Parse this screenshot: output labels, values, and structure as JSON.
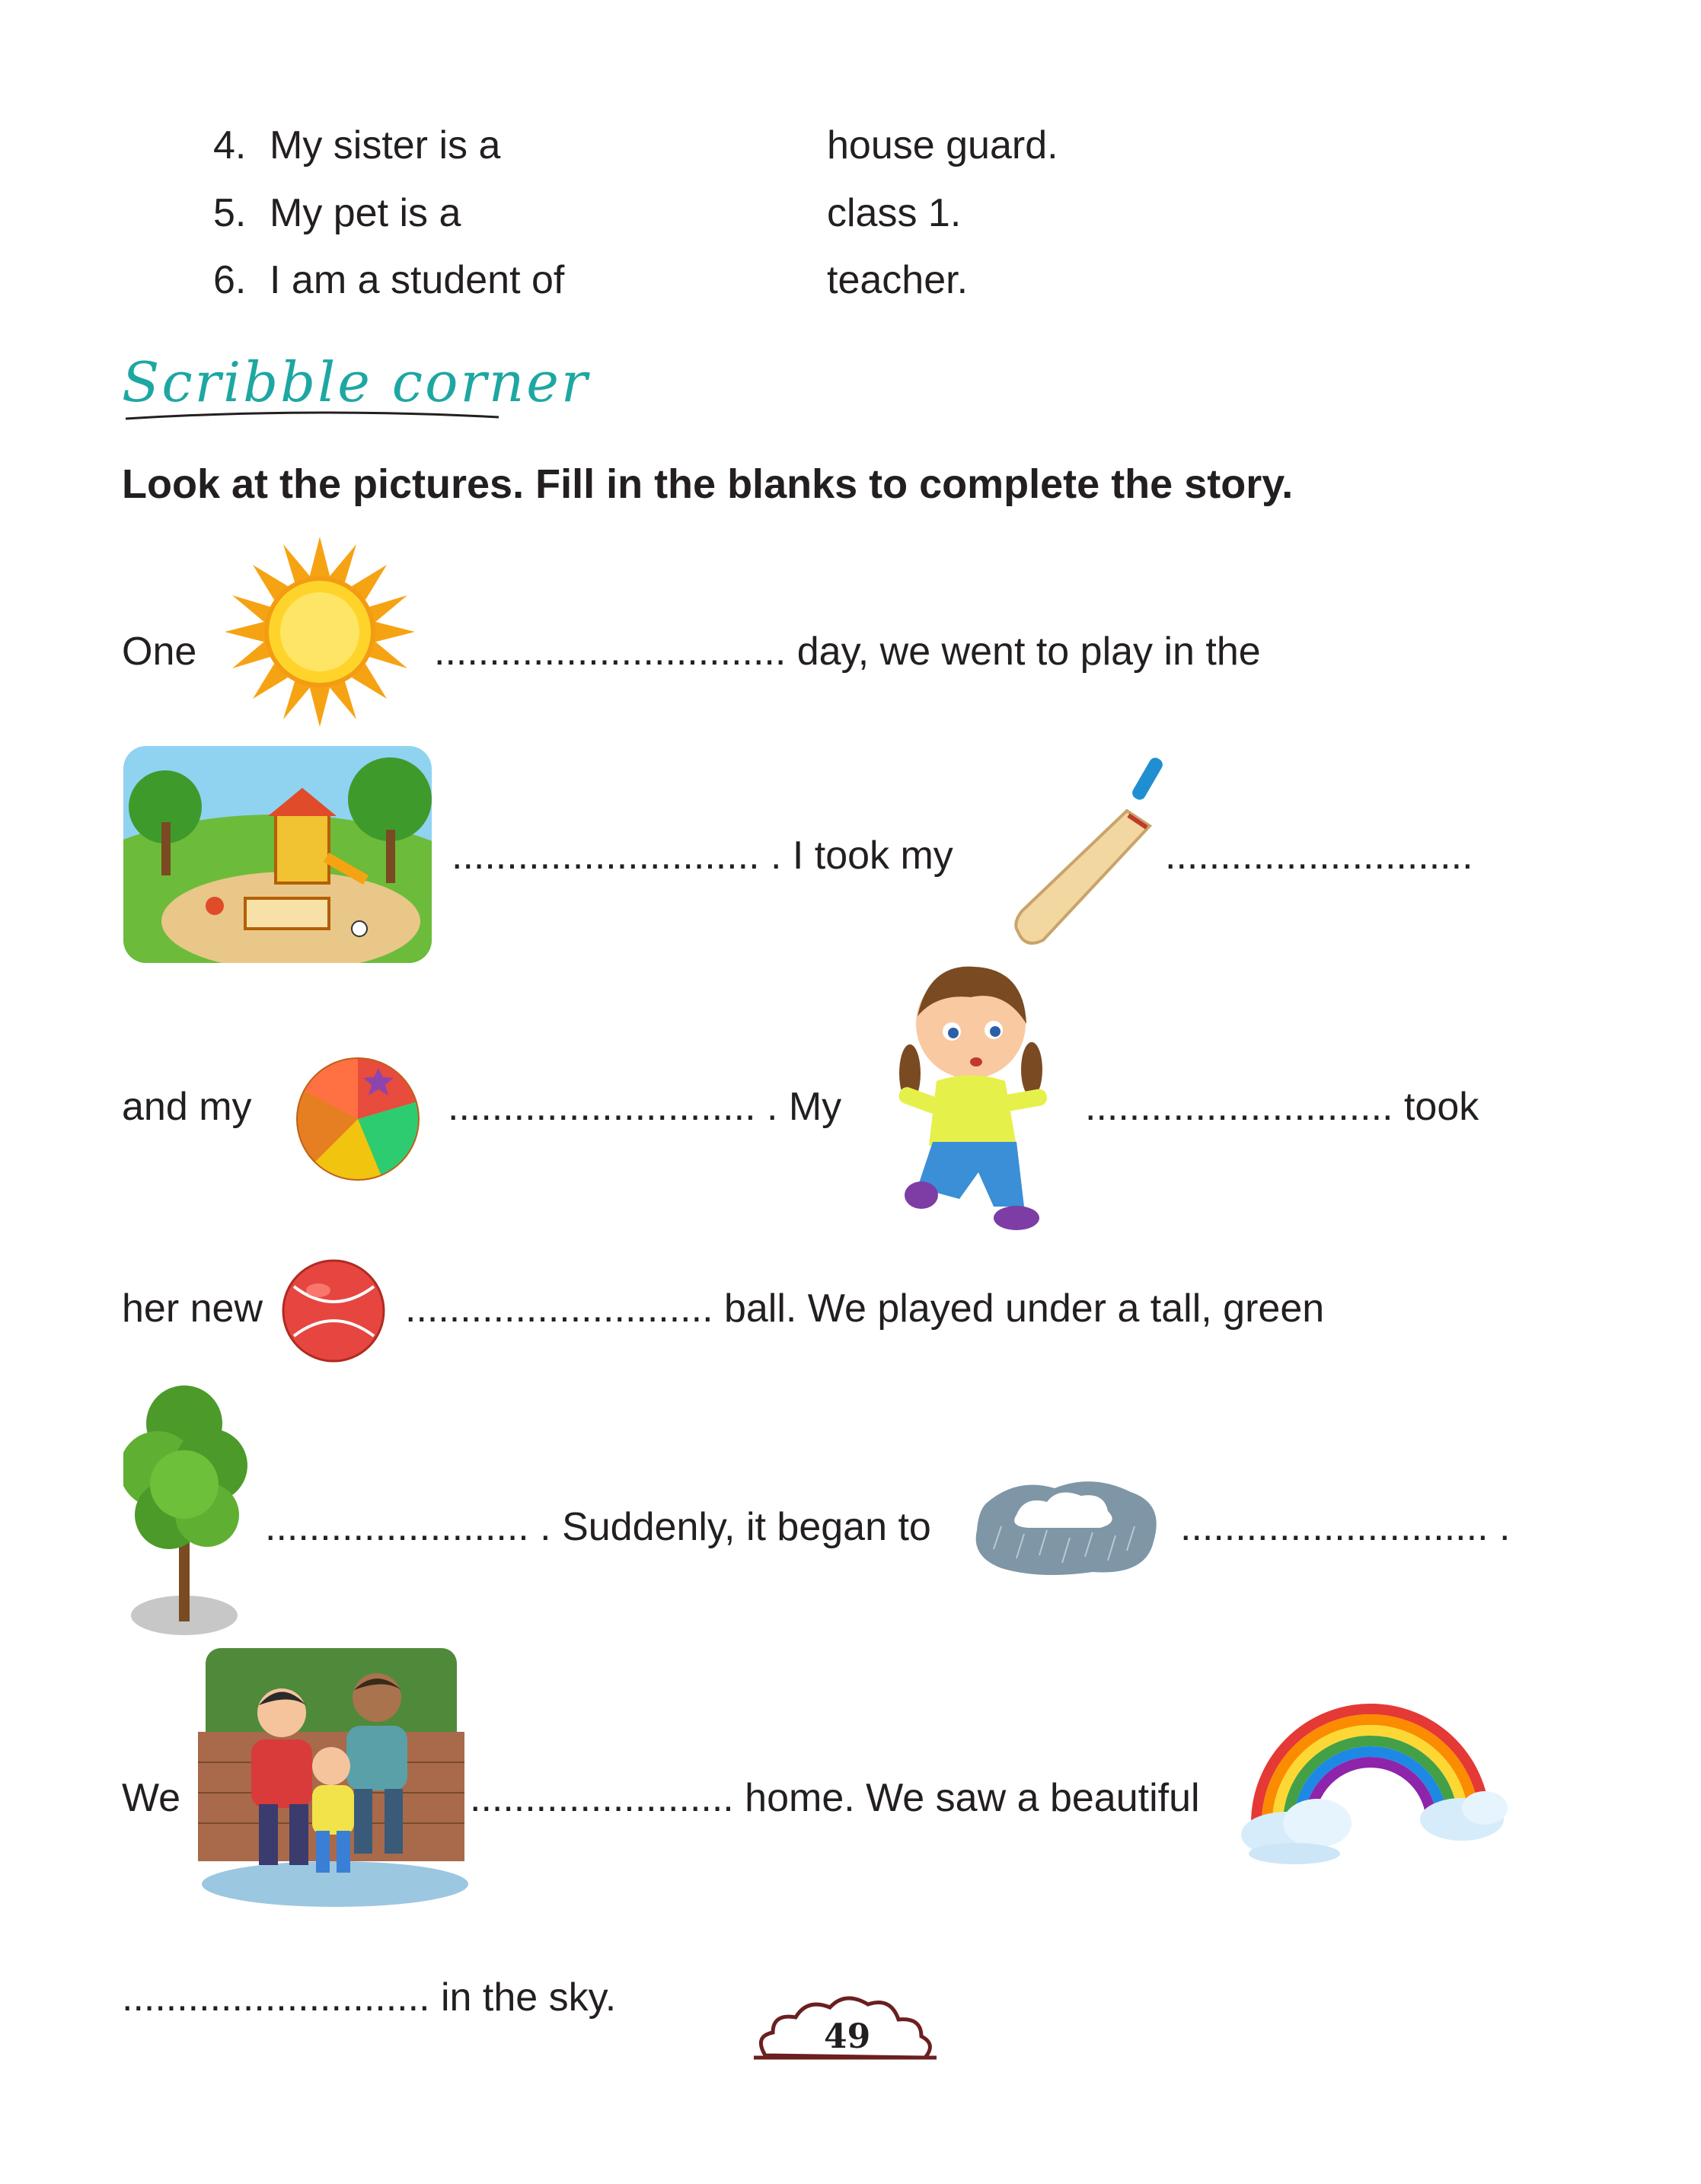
{
  "matching": [
    {
      "num": "4.",
      "left": "My sister is a",
      "right": "house guard."
    },
    {
      "num": "5.",
      "left": "My pet is a",
      "right": "class 1."
    },
    {
      "num": "6.",
      "left": "I am a student of",
      "right": "teacher."
    }
  ],
  "section_heading": "Scribble corner",
  "instruction": "Look at the pictures. Fill in the blanks to complete the story.",
  "story": {
    "l1_a": "One",
    "l1_b": "................................ day, we went to play in the",
    "l2_a": "............................  . I took my",
    "l2_b": "............................",
    "l3_a": "and my",
    "l3_b": "............................ . My",
    "l3_c": "............................ took",
    "l4_a": "her new",
    "l4_b": "............................ ball. We played under a tall, green",
    "l5_a": "........................ .  Suddenly, it began to",
    "l5_b": "............................ .",
    "l6_a": "We",
    "l6_b": "........................ home. We saw a beautiful",
    "l7_a": "............................ in the sky."
  },
  "icons": {
    "sun": "sun-icon",
    "park": "playground-icon",
    "bat": "cricket-bat-icon",
    "beach_ball": "beach-ball-icon",
    "girl": "girl-icon",
    "red_ball": "red-ball-icon",
    "tree": "tree-icon",
    "rain_cloud": "rain-cloud-icon",
    "children": "children-running-icon",
    "rainbow": "rainbow-icon"
  },
  "page_number": "49",
  "colors": {
    "heading": "#1ea7a2",
    "text": "#231f20",
    "page_cloud": "#6b1f1f"
  }
}
